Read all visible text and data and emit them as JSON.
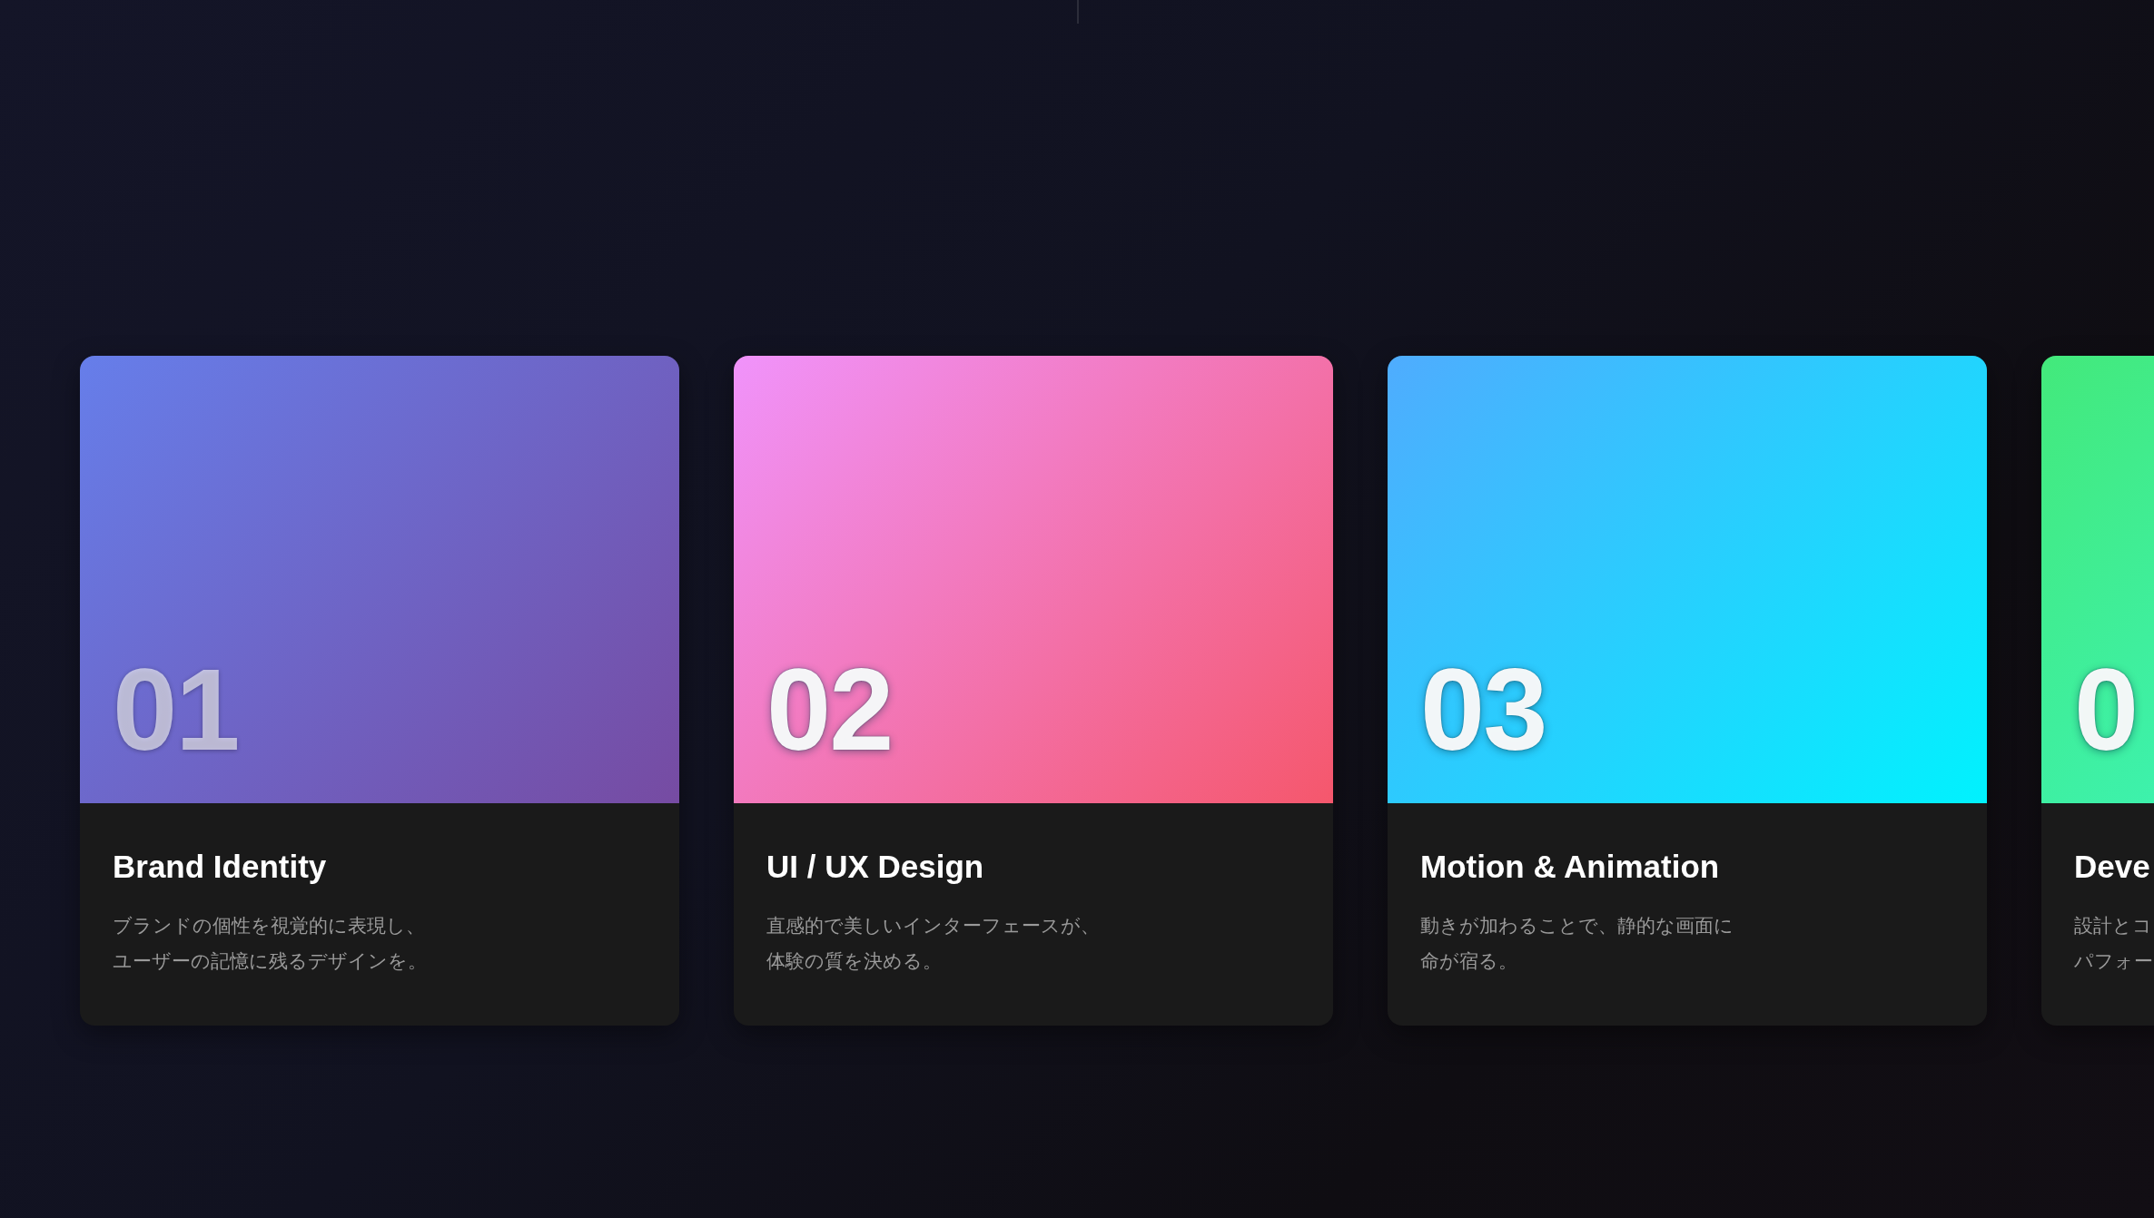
{
  "cards": [
    {
      "number": "01",
      "title": "Brand Identity",
      "description": [
        "ブランドの個性を視覚的に表現し、",
        "ユーザーの記憶に残るデザインを。"
      ],
      "color": "#667eea"
    },
    {
      "number": "02",
      "title": "UI / UX Design",
      "description": [
        "直感的で美しいインターフェースが、",
        "体験の質を決める。"
      ],
      "color": "#f093fb"
    },
    {
      "number": "03",
      "title": "Motion & Animation",
      "description": [
        "動きが加わることで、静的な画面に",
        "命が宿る。"
      ],
      "color": "#4facfe"
    },
    {
      "number": "0",
      "title": "Deve",
      "description": [
        "設計とコ",
        "パフォー"
      ],
      "color": "#43e97b"
    }
  ]
}
